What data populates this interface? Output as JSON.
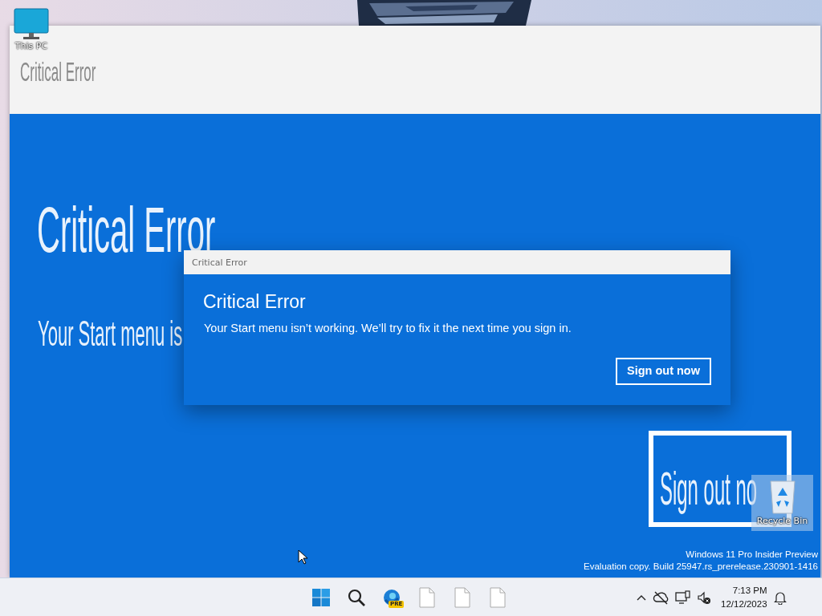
{
  "desktop_icons": [
    {
      "kind": "computer",
      "label": "This PC",
      "selected": false
    },
    {
      "kind": "recycle",
      "label": "Recycle Bin",
      "selected": true
    }
  ],
  "background_window": {
    "header_title": "Critical Error",
    "title": "Critical Error",
    "message": "Your Start menu is",
    "button": "Sign out no"
  },
  "dialog": {
    "title": "Critical Error",
    "heading": "Critical Error",
    "message": "Your Start menu isn’t working. We’ll try to fix it the next time you sign in.",
    "button": "Sign out now"
  },
  "watermark": [
    "Windows 11 Pro Insider Preview",
    "Evaluation copy. Build 25947.rs_prerelease.230901-1416"
  ],
  "taskbar": {
    "apps": [
      {
        "kind": "start"
      },
      {
        "kind": "search"
      },
      {
        "kind": "browser",
        "badge": "PRE"
      },
      {
        "kind": "document"
      },
      {
        "kind": "document"
      },
      {
        "kind": "document"
      }
    ],
    "tray": [
      {
        "kind": "chevron"
      },
      {
        "kind": "cloud-off"
      },
      {
        "kind": "network"
      },
      {
        "kind": "volume-mute"
      }
    ],
    "time": "7:13 PM",
    "date": "12/12/2023"
  }
}
